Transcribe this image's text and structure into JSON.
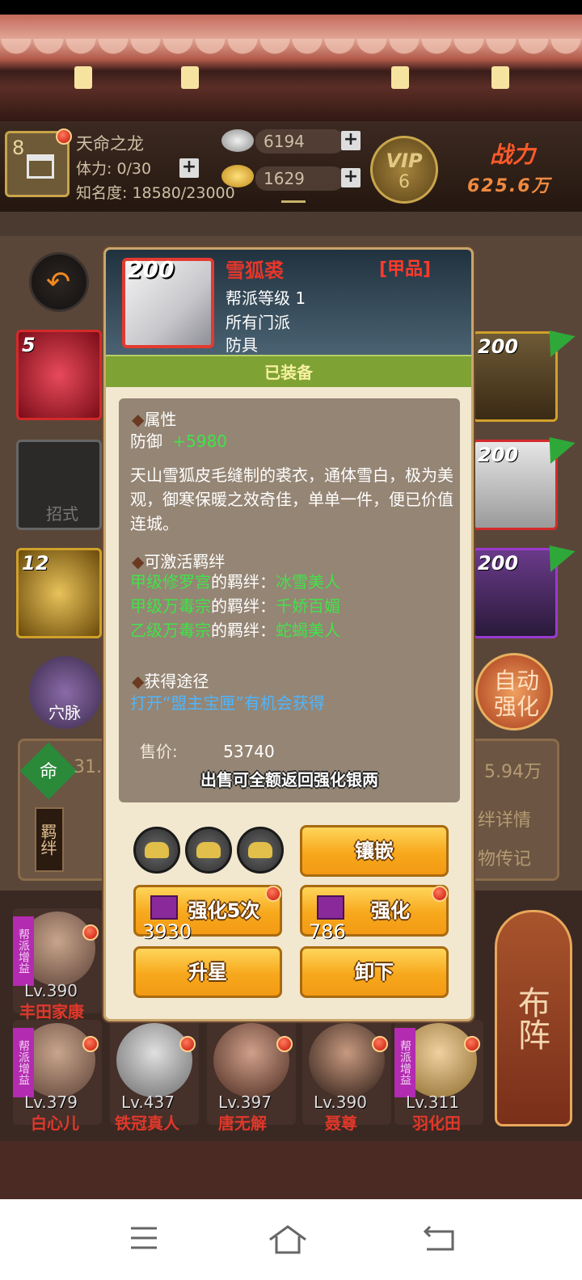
{
  "player": {
    "level": "8",
    "name": "天命之龙",
    "stamina": "体力: 0/30",
    "fame": "知名度: 18580/23000",
    "silver": "6194",
    "gold": "1629",
    "vip_label": "VIP",
    "vip_level": "6",
    "power_label": "战力",
    "power_value": "625.6万"
  },
  "background": {
    "slot_numbers": [
      "5",
      "12",
      "200",
      "200",
      "200"
    ],
    "slot_empty_label": "招式",
    "meridian_label": "穴脉",
    "auto_enhance": "自动强化",
    "fate_label": "命",
    "fate_value": "31.",
    "power_right": "5.94万",
    "bond_label": "羁绊",
    "bond_detail": "绊详情",
    "biography": "物传记",
    "formation": "布阵"
  },
  "heroes": [
    {
      "level": "Lv.390",
      "name": "丰田家康",
      "tag": "帮派增益"
    },
    {
      "level": "Lv.379",
      "name": "白心儿",
      "tag": "帮派增益"
    },
    {
      "level": "Lv.437",
      "name": "铁冠真人",
      "tag": ""
    },
    {
      "level": "Lv.397",
      "name": "唐无解",
      "tag": ""
    },
    {
      "level": "Lv.390",
      "name": "聂尊",
      "tag": ""
    },
    {
      "level": "Lv.311",
      "name": "羽化田",
      "tag": "帮派增益"
    }
  ],
  "item": {
    "level": "200",
    "name": "雪狐裘",
    "grade": "[甲品]",
    "guild_level": "帮派等级 1",
    "sect": "所有门派",
    "type": "防具",
    "status": "已装备",
    "attr_title": "属性",
    "attr_name": "防御",
    "attr_value": "+5980",
    "description": "天山雪狐皮毛缝制的裘衣，通体雪白，极为美观，御寒保暖之效奇佳，单单一件，便已价值连城。",
    "bonds_title": "可激活羁绊",
    "bonds": [
      {
        "source": "甲级修罗宫",
        "mid": "的羁绊：",
        "target": "冰雪美人"
      },
      {
        "source": "甲级万毒宗",
        "mid": "的羁绊：",
        "target": "千娇百媚"
      },
      {
        "source": "乙级万毒宗",
        "mid": "的羁绊：",
        "target": "蛇蝎美人"
      }
    ],
    "obtain_title": "获得途径",
    "obtain_text": "打开“盟主宝匣”有机会获得",
    "price_label": "售价:",
    "price_value": "53740",
    "sell_note": "出售可全额返回强化银两"
  },
  "actions": {
    "inlay": "镶嵌",
    "enhance5": "强化5次",
    "enhance5_cost": "3930",
    "enhance": "强化",
    "enhance_cost": "786",
    "star_up": "升星",
    "unequip": "卸下"
  },
  "colors": {
    "accent_gold": "#f7a81c",
    "grade_red": "#e6362a",
    "equipped_green": "#7ea234",
    "bond_green": "#42e24a",
    "link_blue": "#4db6ff"
  }
}
